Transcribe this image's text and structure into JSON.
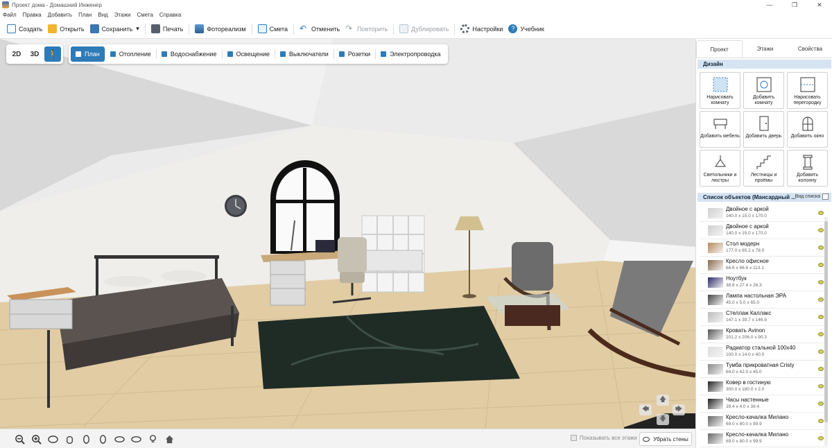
{
  "window": {
    "title": "Проект дома - Домашний Инженер",
    "controls": [
      "—",
      "❐",
      "✕"
    ]
  },
  "menu": [
    "Файл",
    "Правка",
    "Добавить",
    "План",
    "Вид",
    "Этажи",
    "Смета",
    "Справка"
  ],
  "toolbar": {
    "create": "Создать",
    "open": "Открыть",
    "save": "Сохранить",
    "save_arrow": "▾",
    "print": "Печать",
    "photoreal": "Фотореализм",
    "estimate": "Смета",
    "undo": "Отменить",
    "redo": "Повторить",
    "duplicate": "Дублировать",
    "settings": "Настройки",
    "tutorial": "Учебник"
  },
  "view_modes": {
    "two_d": "2D",
    "three_d": "3D",
    "walk": "🚶",
    "active": "walk"
  },
  "layers": [
    "План",
    "Отопление",
    "Водоснабжение",
    "Освещение",
    "Выключатели",
    "Розетки",
    "Электропроводка"
  ],
  "nav_arrows": {
    "up": "🡅",
    "down": "🡇",
    "left": "🡄",
    "right": "🡆"
  },
  "bottom": {
    "show_all_floors": "Показывать все этажи",
    "remove_walls": "Убрать стены"
  },
  "panel": {
    "tabs": [
      "Проект",
      "Этажи",
      "Свойства"
    ],
    "active_tab": "Проект",
    "design_title": "Дизайн",
    "design_items": [
      {
        "label": "Нарисовать комнату",
        "icon": "draw-room-icon"
      },
      {
        "label": "Добавить комнату",
        "icon": "add-room-icon"
      },
      {
        "label": "Нарисовать перегородку",
        "icon": "draw-partition-icon"
      },
      {
        "label": "Добавить мебель",
        "icon": "add-furniture-icon"
      },
      {
        "label": "Добавить дверь",
        "icon": "add-door-icon"
      },
      {
        "label": "Добавить окно",
        "icon": "add-window-icon"
      },
      {
        "label": "Светильники и люстры",
        "icon": "lamps-icon"
      },
      {
        "label": "Лестницы и проёмы",
        "icon": "stairs-icon"
      },
      {
        "label": "Добавить колонну",
        "icon": "column-icon"
      }
    ],
    "objects_title": "Список объектов (Мансардный ...",
    "list_view": "Вид списка",
    "objects": [
      {
        "name": "Двойное с аркой",
        "size": "140.0 x 15.0 x 170.0"
      },
      {
        "name": "Двойное с аркой",
        "size": "140.0 x 15.0 x 170.0"
      },
      {
        "name": "Стол модерн",
        "size": "177.0 x 65.2 x 78.0"
      },
      {
        "name": "Кресло офисное",
        "size": "66.6 x 66.6 x 113.1"
      },
      {
        "name": "Ноутбук",
        "size": "38.6 x 27.4 x 26.3"
      },
      {
        "name": "Лампа настольная ЭРА",
        "size": "45.0 x 5.0 x 65.0"
      },
      {
        "name": "Стеллаж Каллакс",
        "size": "147.1 x 39.7 x 146.9"
      },
      {
        "name": "Кровать Avinon",
        "size": "201.2 x 206.0 x 90.3"
      },
      {
        "name": "Радиатор стальной 100x40",
        "size": "100.0 x 14.0 x 40.0"
      },
      {
        "name": "Тумба прикроватная Cristy",
        "size": "64.0 x 42.0 x 45.0"
      },
      {
        "name": "Ковер в гостиную",
        "size": "300.0 x 180.0 x 2.0"
      },
      {
        "name": "Часы настенные",
        "size": "39.4 x 4.0 x 39.4"
      },
      {
        "name": "Кресло-качалка Милано",
        "size": "69.0 x 80.0 x 99.9"
      },
      {
        "name": "Кресло-качалка Милано",
        "size": "69.0 x 80.0 x 99.9"
      }
    ]
  },
  "colors": {
    "accent": "#2e7bb8",
    "header_blue": "#d6e4f2",
    "floor": "#e3cfa6",
    "rug": "#1e2b24"
  }
}
